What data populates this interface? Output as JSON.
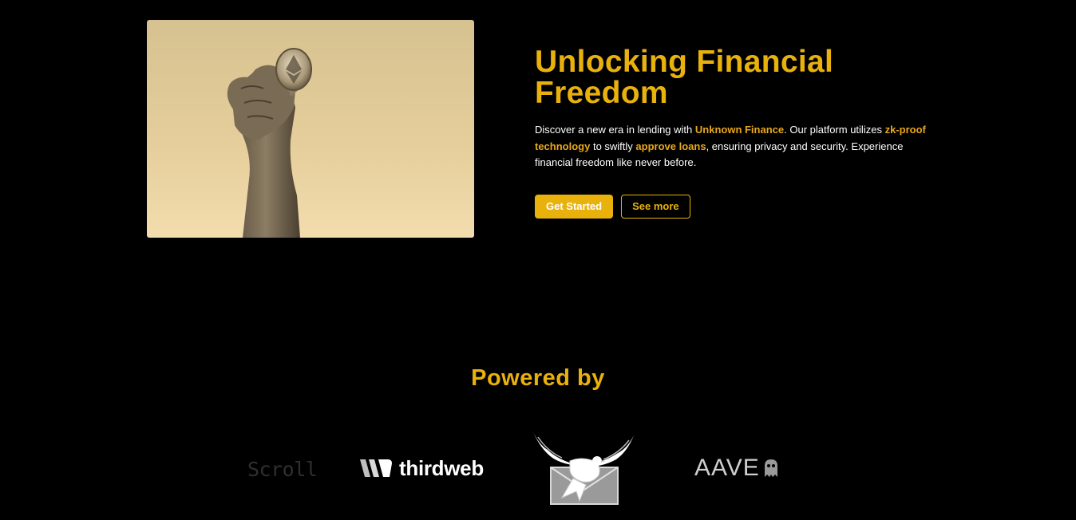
{
  "hero": {
    "image_alt": "Hand holding an Ethereum coin",
    "title": "Unlocking Financial Freedom",
    "description": {
      "part1": "Discover a new era in lending with ",
      "highlight1": "Unknown Finance",
      "part2": ". Our platform utilizes ",
      "highlight2": "zk-proof technology",
      "part3": " to swiftly ",
      "highlight3": "approve loans",
      "part4": ", ensuring privacy and security. Experience financial freedom like never before."
    },
    "primary_button": "Get Started",
    "secondary_button": "See more"
  },
  "powered_by": {
    "title": "Powered by",
    "partners": [
      {
        "name": "Scroll",
        "text": "Scroll",
        "icon": "scroll-logo"
      },
      {
        "name": "thirdweb",
        "text": "thirdweb",
        "icon": "thirdweb-icon"
      },
      {
        "name": "dove",
        "text": "",
        "icon": "dove-envelope-icon"
      },
      {
        "name": "Aave",
        "text": "AAVE",
        "icon": "ghost-icon"
      }
    ]
  },
  "colors": {
    "background": "#000000",
    "accent": "#e9b10c",
    "text": "#ffffff"
  }
}
